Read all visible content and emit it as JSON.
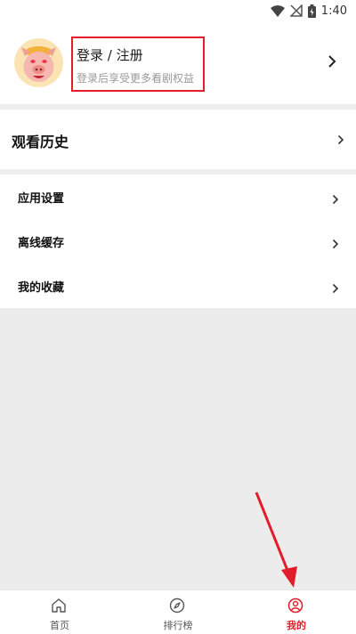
{
  "status_bar": {
    "time": "1:40",
    "icons": [
      "wifi-icon",
      "no-signal-icon",
      "battery-icon"
    ]
  },
  "profile": {
    "login_title": "登录 / 注册",
    "login_subtitle": "登录后享受更多看剧权益",
    "avatar_icon": "cartoon-pig-avatar-icon"
  },
  "history": {
    "label": "观看历史"
  },
  "menu": {
    "items": [
      {
        "label": "应用设置"
      },
      {
        "label": "离线缓存"
      },
      {
        "label": "我的收藏"
      }
    ]
  },
  "tabbar": {
    "tabs": [
      {
        "label": "首页",
        "icon": "home-icon"
      },
      {
        "label": "排行榜",
        "icon": "compass-icon"
      },
      {
        "label": "我的",
        "icon": "user-icon",
        "active": true
      }
    ]
  },
  "colors": {
    "accent": "#e11d2a",
    "separator": "#eeeeee",
    "background_gray": "#ececec"
  }
}
